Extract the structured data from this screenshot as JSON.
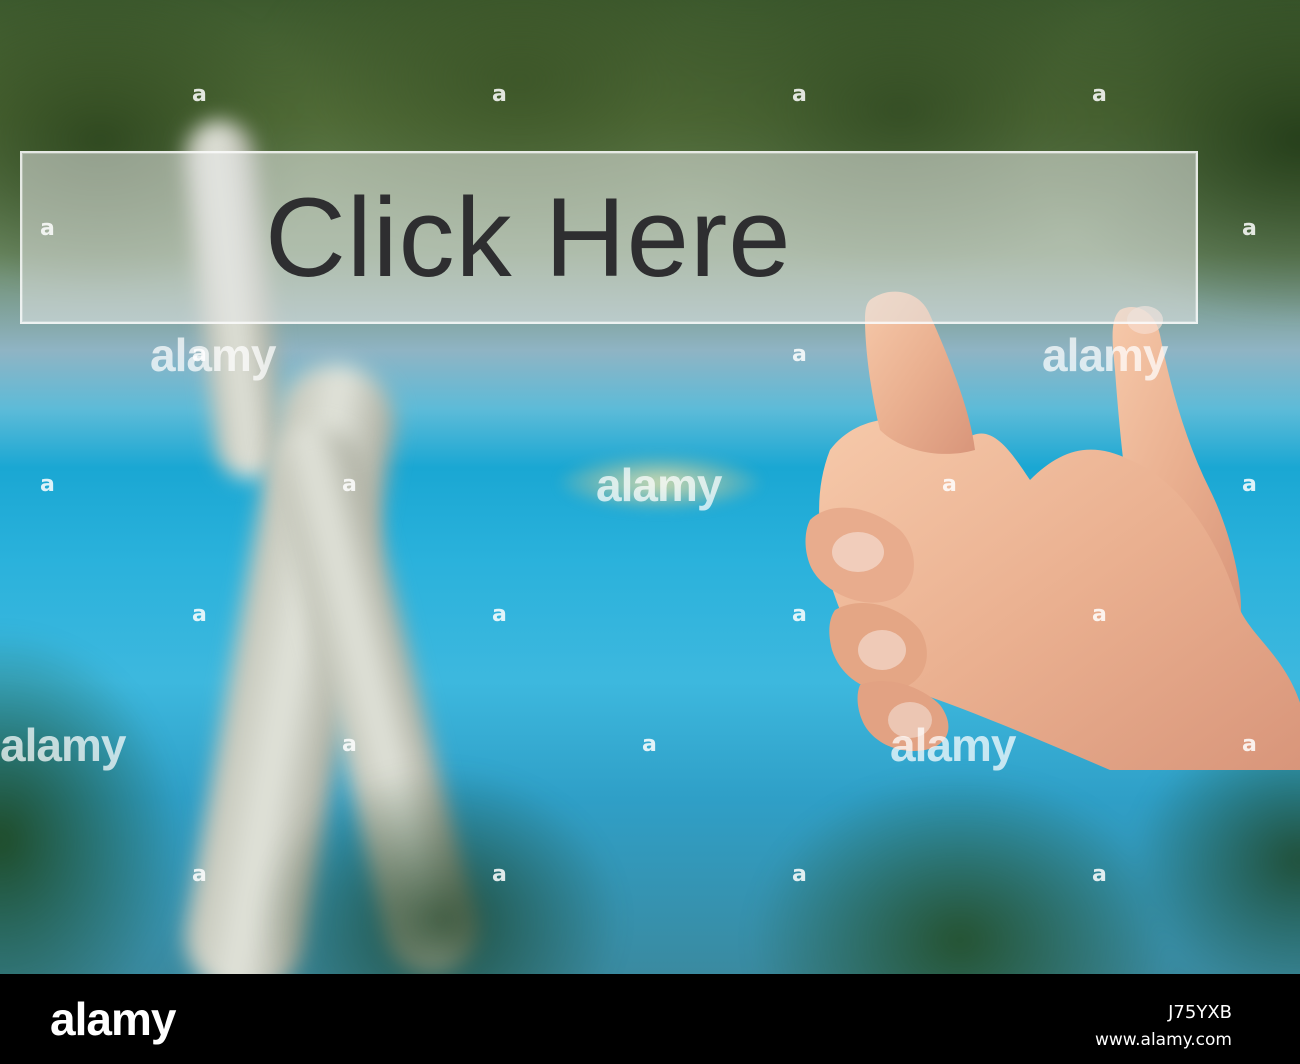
{
  "button": {
    "label": "Click Here"
  },
  "watermark": {
    "logo": "alamy",
    "mark": "a"
  },
  "footer": {
    "logo": "alamy",
    "image_id": "J75YXB",
    "url": "www.alamy.com"
  }
}
